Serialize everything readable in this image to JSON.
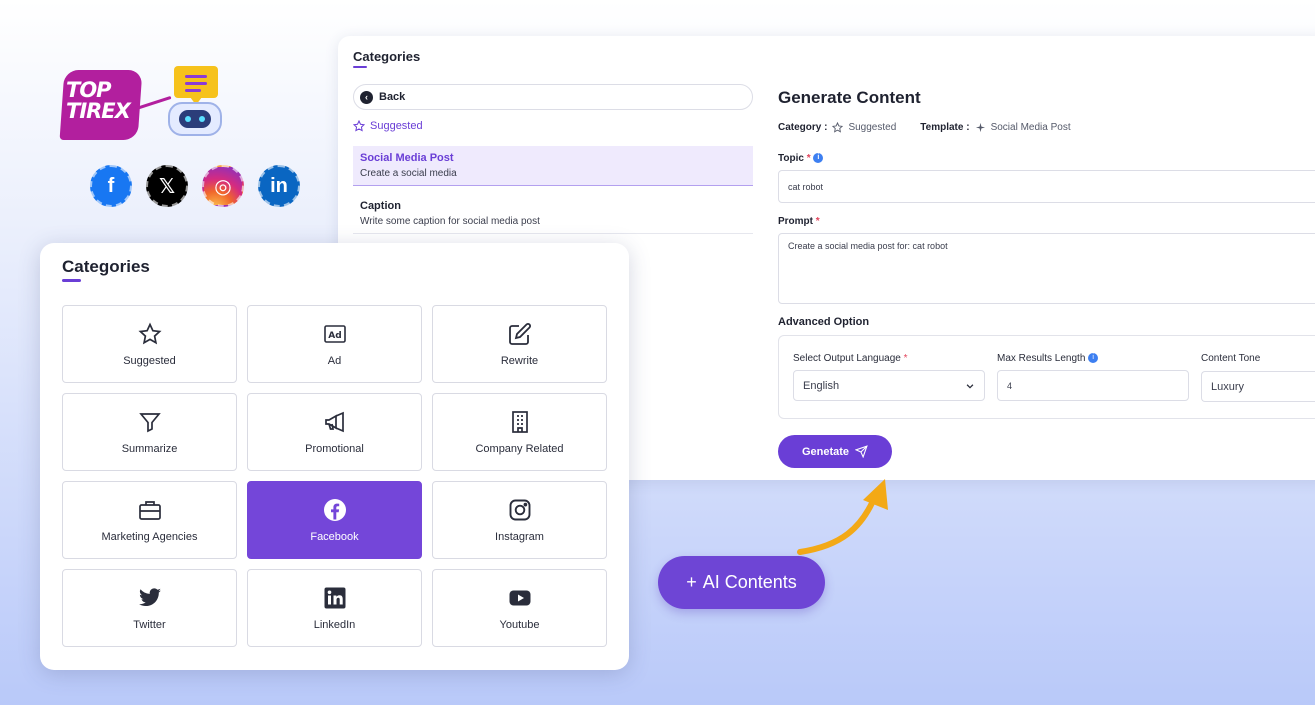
{
  "logo": {
    "line1": "TOP",
    "line2": "TIREX"
  },
  "social": [
    {
      "name": "facebook",
      "glyph": "f"
    },
    {
      "name": "x",
      "glyph": "𝕏"
    },
    {
      "name": "instagram",
      "glyph": "◎"
    },
    {
      "name": "linkedin",
      "glyph": "in"
    }
  ],
  "back_panel": {
    "title": "Categories",
    "back_label": "Back",
    "suggested_label": "Suggested",
    "templates": [
      {
        "title": "Social Media Post",
        "desc": "Create a social media",
        "active": true
      },
      {
        "title": "Caption",
        "desc": "Write some caption for social media post",
        "active": false
      }
    ],
    "generate": {
      "title": "Generate Content",
      "category_label": "Category :",
      "category_value": "Suggested",
      "template_label": "Template :",
      "template_value": "Social Media Post",
      "topic_label": "Topic",
      "topic_value": "cat robot",
      "prompt_label": "Prompt",
      "prompt_value": "Create a social media post for: cat robot",
      "advanced_title": "Advanced Option",
      "language_label": "Select Output Language",
      "language_value": "English",
      "max_results_label": "Max Results Length",
      "max_results_value": "4",
      "tone_label": "Content Tone",
      "tone_value": "Luxury",
      "button_label": "Genetate"
    }
  },
  "front_panel": {
    "title": "Categories",
    "categories": [
      {
        "label": "Suggested",
        "icon": "star-icon",
        "active": false
      },
      {
        "label": "Ad",
        "icon": "ad-icon",
        "active": false
      },
      {
        "label": "Rewrite",
        "icon": "edit-icon",
        "active": false
      },
      {
        "label": "Summarize",
        "icon": "filter-icon",
        "active": false
      },
      {
        "label": "Promotional",
        "icon": "megaphone-icon",
        "active": false
      },
      {
        "label": "Company Related",
        "icon": "building-icon",
        "active": false
      },
      {
        "label": "Marketing Agencies",
        "icon": "briefcase-icon",
        "active": false
      },
      {
        "label": "Facebook",
        "icon": "facebook-icon",
        "active": true
      },
      {
        "label": "Instagram",
        "icon": "instagram-icon",
        "active": false
      },
      {
        "label": "Twitter",
        "icon": "twitter-icon",
        "active": false
      },
      {
        "label": "LinkedIn",
        "icon": "linkedin-icon",
        "active": false
      },
      {
        "label": "Youtube",
        "icon": "youtube-icon",
        "active": false
      }
    ]
  },
  "ai_pill": {
    "plus": "+",
    "label": "AI Contents"
  },
  "colors": {
    "accent": "#6a3ed6",
    "active_tile": "#7446d9",
    "arrow": "#f3a916"
  }
}
